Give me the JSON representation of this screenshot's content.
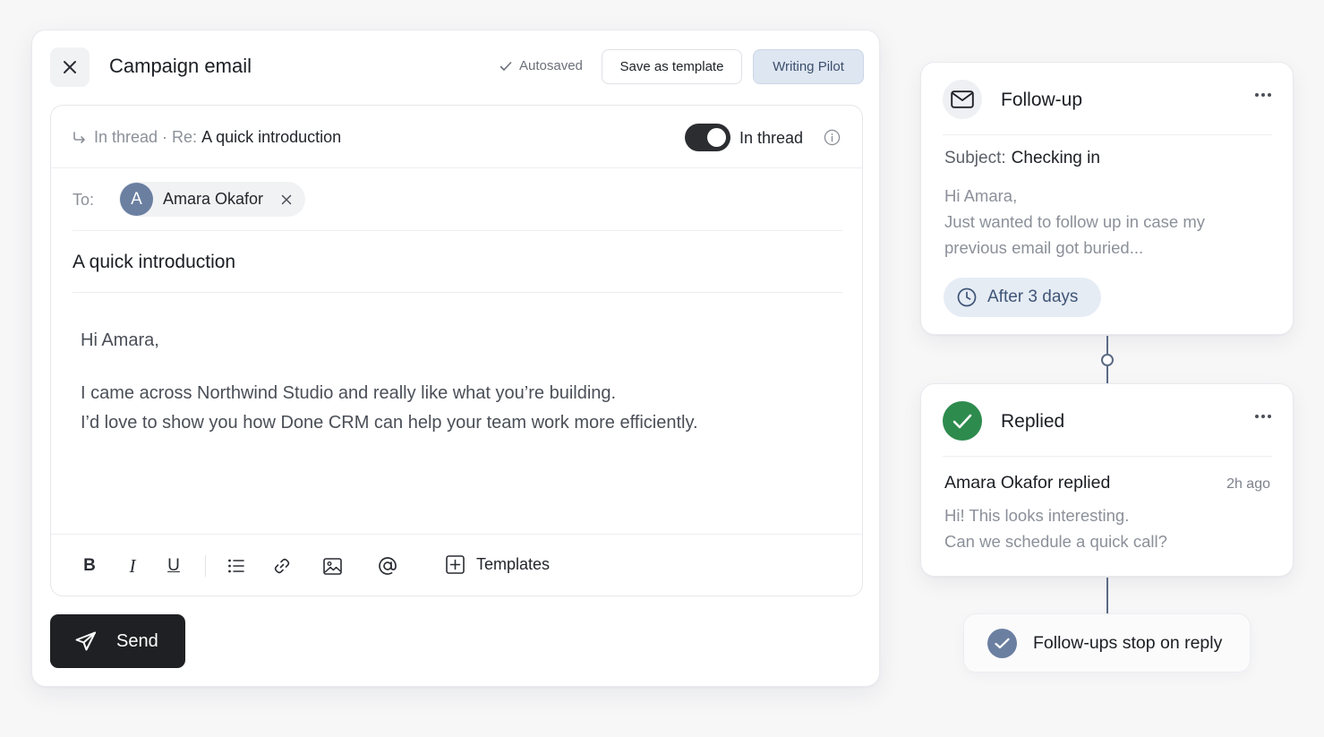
{
  "composer": {
    "title": "Campaign email",
    "autosaved": "Autosaved",
    "save_template": "Save as template",
    "writing_pilot": "Writing Pilot",
    "thread": {
      "prefix": "In thread · Re:",
      "subject": "A quick introduction",
      "toggle_on": true,
      "toggle_label": "In thread"
    },
    "to_label": "To:",
    "recipient": {
      "initial": "A",
      "name": "Amara Okafor"
    },
    "subject": "A quick introduction",
    "body": {
      "greeting": "Hi Amara,",
      "line1": "I came across Northwind Studio and really like what you’re building.",
      "line2": "I’d love to show you how Done CRM can help your team work more efficiently."
    },
    "toolbar": {
      "bold": "B",
      "italic": "I",
      "underline": "U",
      "templates": "Templates"
    },
    "send": "Send"
  },
  "followup": {
    "title": "Follow-up",
    "subject_label": "Subject:",
    "subject": "Checking in",
    "preview_line1": "Hi Amara,",
    "preview_line2": "Just wanted to follow up in case my",
    "preview_line3": "previous email got buried...",
    "delay": "After 3 days"
  },
  "replied": {
    "title": "Replied",
    "from": "Amara Okafor replied",
    "time": "2h ago",
    "preview_line1": "Hi! This looks interesting.",
    "preview_line2": "Can we schedule a quick call?"
  },
  "stop_note": "Follow-ups stop on reply",
  "colors": {
    "send_bg": "#1f2023",
    "pilot_bg": "#dde6f1",
    "avatar": "#6b7fa1",
    "success": "#2e8b4e",
    "connector": "#5a6a84"
  }
}
